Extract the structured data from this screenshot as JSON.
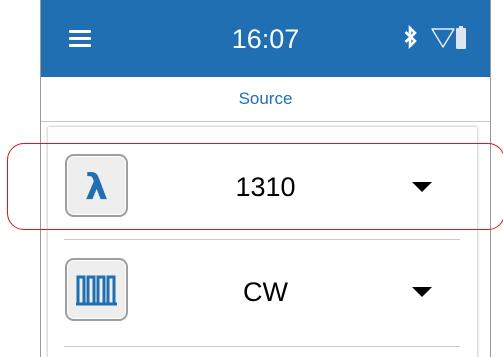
{
  "status_bar": {
    "time": "16:07",
    "icons": [
      "menu-icon",
      "bluetooth-icon",
      "wifi-icon",
      "battery-icon"
    ],
    "background_color": "#1f6fb2"
  },
  "section": {
    "title": "Source"
  },
  "source_settings": [
    {
      "icon": "wavelength-lambda-icon",
      "icon_glyph": "λ",
      "value": "1310"
    },
    {
      "icon": "modulation-pulse-icon",
      "value": "CW"
    }
  ],
  "colors": {
    "accent": "#1f6fb2",
    "highlight": "#e0141c"
  }
}
